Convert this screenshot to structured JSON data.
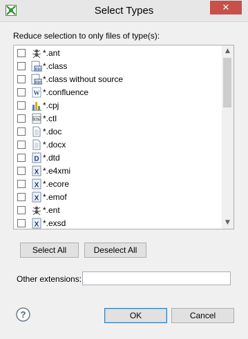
{
  "window": {
    "title": "Select Types",
    "close_glyph": "✕"
  },
  "instruction": "Reduce selection to only files of type(s):",
  "types": [
    {
      "label": "*.ant",
      "icon": "ant-icon",
      "checked": false
    },
    {
      "label": "*.class",
      "icon": "binary-class-icon",
      "checked": false
    },
    {
      "label": "*.class without source",
      "icon": "binary-class-icon",
      "checked": false
    },
    {
      "label": "*.confluence",
      "icon": "word-document-icon",
      "checked": false
    },
    {
      "label": "*.cpj",
      "icon": "bar-chart-icon",
      "checked": false
    },
    {
      "label": "*.ctl",
      "icon": "ctl-file-icon",
      "checked": false
    },
    {
      "label": "*.doc",
      "icon": "text-document-icon",
      "checked": false
    },
    {
      "label": "*.docx",
      "icon": "text-document-icon",
      "checked": false
    },
    {
      "label": "*.dtd",
      "icon": "dtd-file-icon",
      "checked": false
    },
    {
      "label": "*.e4xmi",
      "icon": "xml-file-icon",
      "checked": false
    },
    {
      "label": "*.ecore",
      "icon": "xml-file-icon",
      "checked": false
    },
    {
      "label": "*.emof",
      "icon": "xml-file-icon",
      "checked": false
    },
    {
      "label": "*.ent",
      "icon": "ant-icon",
      "checked": false
    },
    {
      "label": "*.exsd",
      "icon": "xml-file-icon",
      "checked": false
    }
  ],
  "buttons": {
    "select_all": "Select All",
    "deselect_all": "Deselect All",
    "ok": "OK",
    "cancel": "Cancel"
  },
  "other_extensions": {
    "label": "Other extensions:",
    "value": ""
  },
  "colors": {
    "close_button": "#c7504a",
    "dialog_bg": "#f0f0f0",
    "default_button_border": "#3c7fb1"
  }
}
